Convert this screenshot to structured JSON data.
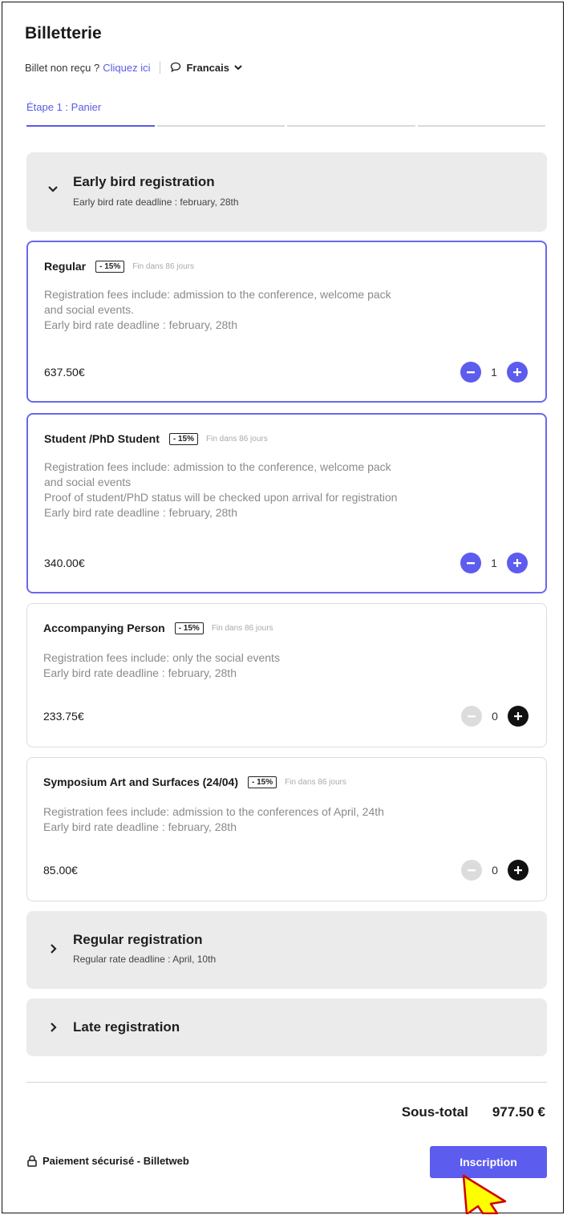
{
  "header": {
    "title": "Billetterie",
    "ticket_not_received": "Billet non reçu ?",
    "click_here": "Cliquez ici",
    "language": "Francais"
  },
  "steps": {
    "current_label": "Étape 1 : Panier",
    "count": 4,
    "active_index": 0
  },
  "groups": {
    "early": {
      "title": "Early bird registration",
      "subtitle": "Early bird rate deadline : february, 28th",
      "expanded": true
    },
    "regular": {
      "title": "Regular registration",
      "subtitle": "Regular rate deadline : April, 10th",
      "expanded": false
    },
    "late": {
      "title": "Late registration",
      "expanded": false
    }
  },
  "tickets": [
    {
      "name": "Regular",
      "discount": "- 15%",
      "ends": "Fin dans 86 jours",
      "desc1": "Registration fees include: admission to the conference, welcome pack",
      "desc2": "and social events.",
      "desc3": "Early bird rate deadline : february, 28th",
      "price": "637.50€",
      "qty": "1",
      "selected": true
    },
    {
      "name": "Student /PhD Student",
      "discount": "- 15%",
      "ends": "Fin dans 86 jours",
      "desc1": "Registration fees include: admission to the conference, welcome pack",
      "desc2": "and social events",
      "desc3": "Proof of student/PhD status will be checked upon arrival for registration",
      "desc4": "Early bird rate deadline : february, 28th",
      "price": "340.00€",
      "qty": "1",
      "selected": true
    },
    {
      "name": "Accompanying Person",
      "discount": "- 15%",
      "ends": "Fin dans 86 jours",
      "desc1": "Registration fees include: only the social events",
      "desc2": "Early bird rate deadline : february, 28th",
      "price": "233.75€",
      "qty": "0",
      "selected": false
    },
    {
      "name": "Symposium Art and Surfaces (24/04)",
      "discount": "- 15%",
      "ends": "Fin dans 86 jours",
      "desc1": "Registration fees include: admission to the conferences of April, 24th",
      "desc2": "Early bird rate deadline : february, 28th",
      "price": "85.00€",
      "qty": "0",
      "selected": false
    }
  ],
  "footer": {
    "subtotal_label": "Sous-total",
    "subtotal_value": "977.50 €",
    "secure_payment": "Paiement sécurisé - Billetweb",
    "cta": "Inscription"
  },
  "colors": {
    "accent": "#5c5cee",
    "group_bg": "#ebebeb",
    "cursor": "#ffff00"
  }
}
